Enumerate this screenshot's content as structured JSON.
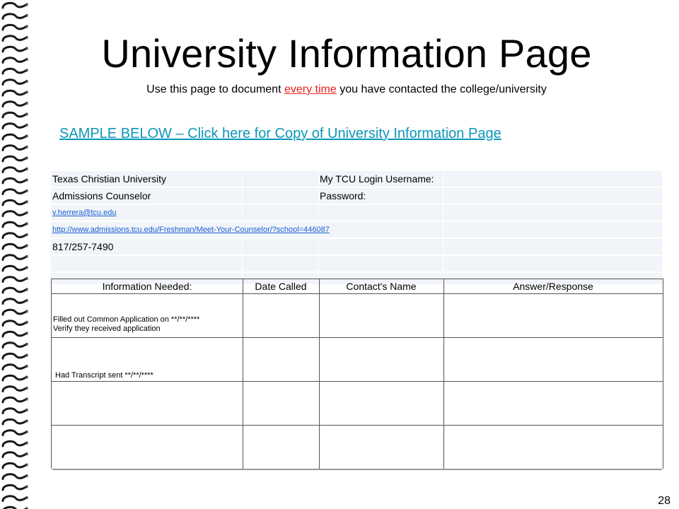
{
  "page": {
    "title": "University Information Page",
    "subtitle_before": "Use this page to document ",
    "subtitle_emphasis": "every time",
    "subtitle_after": " you have contacted the college/university",
    "sample_link": "SAMPLE BELOW – Click here for Copy of University Information Page",
    "page_number": "28"
  },
  "info": {
    "university": "Texas Christian University",
    "login_label": "My TCU Login Username:",
    "counselor": "Admissions Counselor",
    "password_label": "Password:",
    "email": "v.herrera@tcu.edu",
    "url": "http://www.admissions.tcu.edu/Freshman/Meet-Your-Counselor/?school=446087",
    "phone": "817/257-7490"
  },
  "table": {
    "headers": [
      "Information Needed:",
      "Date Called",
      "Contact's Name",
      "Answer/Response"
    ],
    "rows": [
      {
        "line1": "Filled out Common Application on **/**/****",
        "line2": "Verify they received application"
      },
      {
        "line1": "Had Transcript sent **/**/****",
        "line2": ""
      },
      {
        "line1": "",
        "line2": ""
      },
      {
        "line1": "",
        "line2": ""
      }
    ]
  },
  "colors": {
    "link": "#0b97b8",
    "emphasis": "#e8211a",
    "info_bg": "#f1f4f8"
  }
}
